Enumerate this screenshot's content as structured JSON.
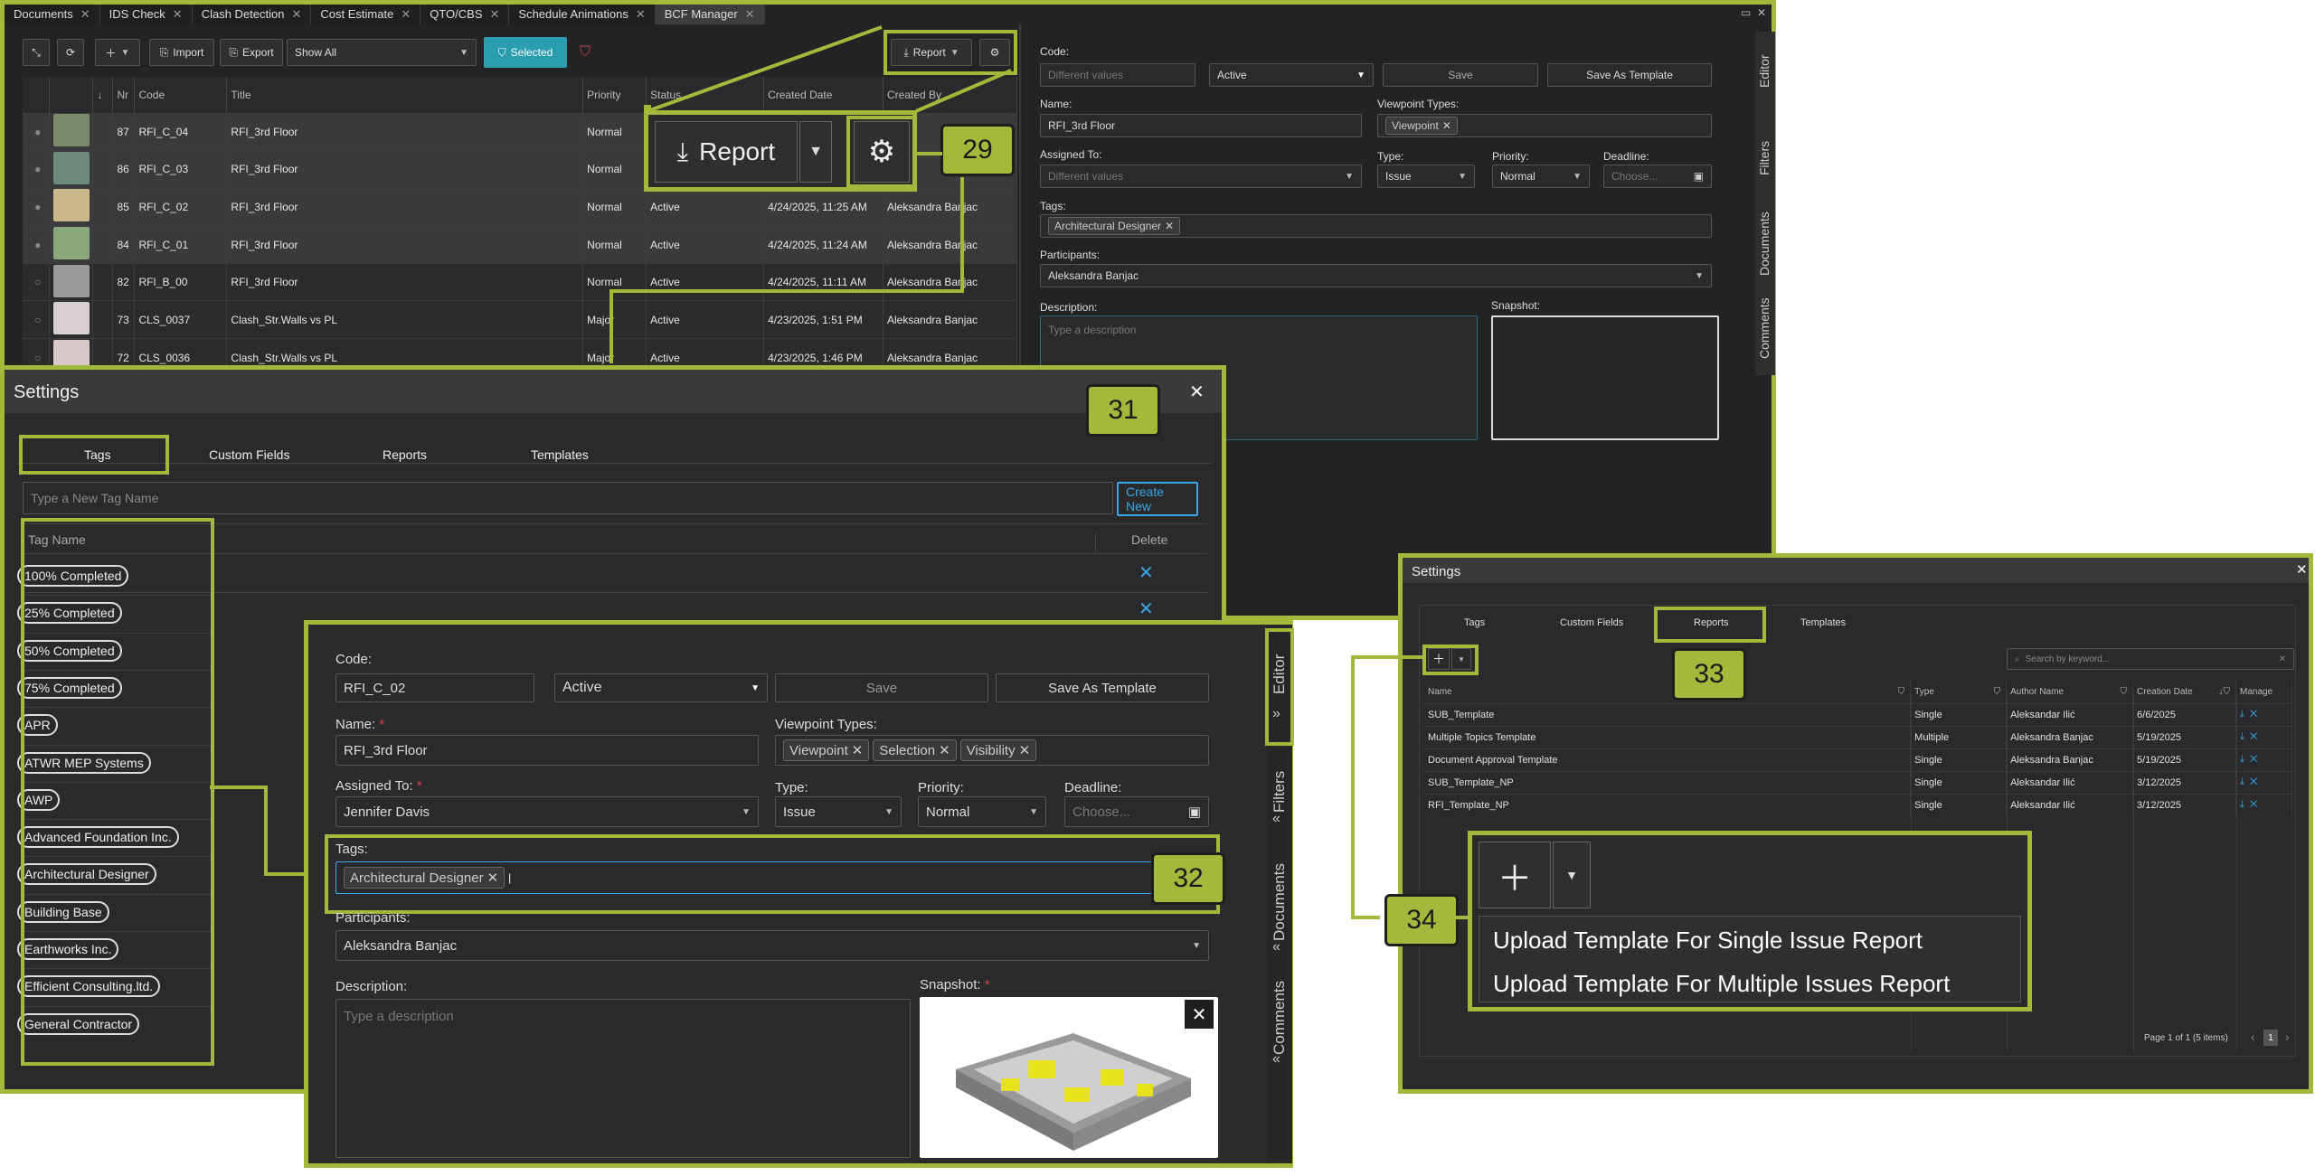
{
  "tabs": [
    {
      "label": "Documents"
    },
    {
      "label": "IDS Check"
    },
    {
      "label": "Clash Detection"
    },
    {
      "label": "Cost Estimate"
    },
    {
      "label": "QTO/CBS"
    },
    {
      "label": "Schedule Animations"
    },
    {
      "label": "BCF Manager"
    }
  ],
  "toolbar": {
    "import": "Import",
    "export": "Export",
    "filter": "Show All",
    "selected": "Selected",
    "report": "Report"
  },
  "grid": {
    "headers": [
      "Nr",
      "Code",
      "Title",
      "Priority",
      "Status",
      "Created Date",
      "Created By"
    ],
    "rows": [
      {
        "nr": "87",
        "code": "RFI_C_04",
        "title": "RFI_3rd Floor",
        "priority": "Normal",
        "status": "",
        "date": "",
        "by": "",
        "thumb": "#7a8a6a"
      },
      {
        "nr": "86",
        "code": "RFI_C_03",
        "title": "RFI_3rd Floor",
        "priority": "Normal",
        "status": "",
        "date": "",
        "by": "",
        "thumb": "#6d8a7a"
      },
      {
        "nr": "85",
        "code": "RFI_C_02",
        "title": "RFI_3rd Floor",
        "priority": "Normal",
        "status": "Active",
        "date": "4/24/2025, 11:25 AM",
        "by": "Aleksandra Banjac",
        "thumb": "#c9b98a"
      },
      {
        "nr": "84",
        "code": "RFI_C_01",
        "title": "RFI_3rd Floor",
        "priority": "Normal",
        "status": "Active",
        "date": "4/24/2025, 11:24 AM",
        "by": "Aleksandra Banjac",
        "thumb": "#8aa67a"
      },
      {
        "nr": "82",
        "code": "RFI_B_00",
        "title": "RFI_3rd Floor",
        "priority": "Normal",
        "status": "Active",
        "date": "4/24/2025, 11:11 AM",
        "by": "Aleksandra Banjac",
        "thumb": "#9a9a9a"
      },
      {
        "nr": "73",
        "code": "CLS_0037",
        "title": "Clash_Str.Walls vs PL",
        "priority": "Major",
        "status": "Active",
        "date": "4/23/2025, 1:51 PM",
        "by": "Aleksandra Banjac",
        "thumb": "#d8d0d0"
      },
      {
        "nr": "72",
        "code": "CLS_0036",
        "title": "Clash_Str.Walls vs PL",
        "priority": "Major",
        "status": "Active",
        "date": "4/23/2025, 1:46 PM",
        "by": "Aleksandra Banjac",
        "thumb": "#d8c8c8"
      }
    ]
  },
  "editor_top": {
    "code_label": "Code:",
    "code_placeholder": "Different values",
    "status": "Active",
    "save": "Save",
    "save_template": "Save As Template",
    "name_label": "Name:",
    "name": "RFI_3rd Floor",
    "vp_label": "Viewpoint Types:",
    "vp_chip": "Viewpoint",
    "assigned_label": "Assigned To:",
    "assigned_placeholder": "Different values",
    "type_label": "Type:",
    "type": "Issue",
    "priority_label": "Priority:",
    "priority": "Normal",
    "deadline_label": "Deadline:",
    "deadline_placeholder": "Choose...",
    "tags_label": "Tags:",
    "tag": "Architectural Designer",
    "participants_label": "Participants:",
    "participant": "Aleksandra Banjac",
    "desc_label": "Description:",
    "desc_placeholder": "Type a description",
    "snapshot_label": "Snapshot:"
  },
  "side_tabs": {
    "editor": "Editor",
    "filters": "Filters",
    "documents": "Documents",
    "comments": "Comments"
  },
  "callouts": {
    "c29": "29",
    "c31": "31",
    "c32": "32",
    "c33": "33",
    "c34": "34"
  },
  "settings": {
    "title": "Settings",
    "tabs": [
      "Tags",
      "Custom Fields",
      "Reports",
      "Templates"
    ],
    "new_tag_placeholder": "Type a New Tag Name",
    "create_new": "Create New",
    "col_tag": "Tag Name",
    "col_delete": "Delete",
    "tags": [
      "100% Completed",
      "25% Completed",
      "50% Completed",
      "75% Completed",
      "APR",
      "ATWR MEP Systems",
      "AWP",
      "Advanced Foundation Inc.",
      "Architectural Designer",
      "Building Base",
      "Earthworks Inc.",
      "Efficient Consulting.ltd.",
      "General Contractor"
    ]
  },
  "editor_zoom": {
    "code_label": "Code:",
    "code": "RFI_C_02",
    "status": "Active",
    "save": "Save",
    "save_template": "Save As Template",
    "name_label": "Name:",
    "req": "*",
    "name": "RFI_3rd Floor",
    "vp_label": "Viewpoint Types:",
    "vp_chips": [
      "Viewpoint",
      "Selection",
      "Visibility"
    ],
    "assigned_label": "Assigned To:",
    "assigned": "Jennifer Davis",
    "type_label": "Type:",
    "type": "Issue",
    "priority_label": "Priority:",
    "priority": "Normal",
    "deadline_label": "Deadline:",
    "deadline_placeholder": "Choose...",
    "tags_label": "Tags:",
    "tag": "Architectural Designer",
    "participants_label": "Participants:",
    "participant": "Aleksandra Banjac",
    "desc_label": "Description:",
    "desc_placeholder": "Type a description",
    "snapshot_label": "Snapshot:"
  },
  "reports": {
    "title": "Settings",
    "tabs": [
      "Tags",
      "Custom Fields",
      "Reports",
      "Templates"
    ],
    "search_placeholder": "Search by keyword...",
    "headers": [
      "Name",
      "Type",
      "Author Name",
      "Creation Date",
      "Manage"
    ],
    "rows": [
      {
        "name": "SUB_Template",
        "type": "Single",
        "author": "Aleksandar Ilić",
        "date": "6/6/2025"
      },
      {
        "name": "Multiple Topics Template",
        "type": "Multiple",
        "author": "Aleksandra Banjac",
        "date": "5/19/2025"
      },
      {
        "name": "Document Approval Template",
        "type": "Single",
        "author": "Aleksandra Banjac",
        "date": "5/19/2025"
      },
      {
        "name": "SUB_Template_NP",
        "type": "Single",
        "author": "Aleksandar Ilić",
        "date": "3/12/2025"
      },
      {
        "name": "RFI_Template_NP",
        "type": "Single",
        "author": "Aleksandar Ilić",
        "date": "3/12/2025"
      }
    ],
    "menu": [
      "Upload Template For Single Issue Report",
      "Upload Template For Multiple Issues Report"
    ],
    "pager": "Page 1 of 1 (5 items)",
    "page": "1"
  }
}
